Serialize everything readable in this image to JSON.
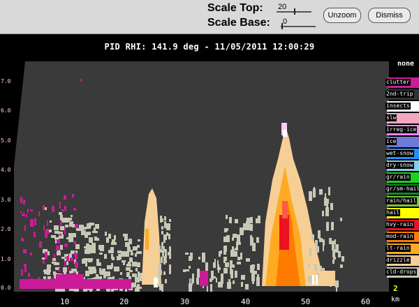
{
  "controls": {
    "scale_top_label": "Scale Top:",
    "scale_top_value": "20",
    "scale_base_label": "Scale Base:",
    "scale_base_value": "0",
    "unzoom_label": "Unzoom",
    "dismiss_label": "Dismiss"
  },
  "title": "PID  RHI: 141.9 deg  -  11/05/2011 12:00:29",
  "y_ticks": [
    "7.0",
    "6.0",
    "5.0",
    "4.0",
    "3.0",
    "2.0",
    "1.0",
    "0.0"
  ],
  "x_ticks": [
    "10",
    "20",
    "30",
    "40",
    "50",
    "60"
  ],
  "x_unit": "km",
  "legend": {
    "title": "none",
    "items": [
      {
        "label": "clutter",
        "color": "#cc1b99"
      },
      {
        "label": "2nd-trip",
        "color": "#333333"
      },
      {
        "label": "insects",
        "color": "#ffffff"
      },
      {
        "label": "slw",
        "color": "#f4a8c0"
      },
      {
        "label": "irreg-ice",
        "color": "#ee88ee"
      },
      {
        "label": "ice",
        "color": "#6e7ad8"
      },
      {
        "label": "wet-snow",
        "color": "#1e90ff"
      },
      {
        "label": "dry-snow",
        "color": "#87ceeb"
      },
      {
        "label": "gr/rain",
        "color": "#1dd21d"
      },
      {
        "label": "gr/sm-hail",
        "color": "#0f8f2f"
      },
      {
        "label": "rain/hail",
        "color": "#7cc33b"
      },
      {
        "label": "hail",
        "color": "#ffff00"
      },
      {
        "label": "hvy-rain",
        "color": "#ee1122"
      },
      {
        "label": "mod-rain",
        "color": "#ff7b00"
      },
      {
        "label": "lt-rain",
        "color": "#ffaa22"
      },
      {
        "label": "drizzle",
        "color": "#f6cf96"
      },
      {
        "label": "cld-drops",
        "color": "#c8c8b6"
      }
    ],
    "corner_value": "2"
  },
  "chart_data": {
    "type": "heatmap",
    "title": "PID  RHI: 141.9 deg  -  11/05/2011 12:00:29",
    "xlabel": "km",
    "ylabel": "",
    "xlim": [
      0,
      65
    ],
    "ylim": [
      0,
      7.5
    ],
    "x_ticks": [
      10,
      20,
      30,
      40,
      50,
      60
    ],
    "y_ticks": [
      0,
      1,
      2,
      3,
      4,
      5,
      6,
      7
    ],
    "categories": [
      "clutter",
      "2nd-trip",
      "insects",
      "slw",
      "irreg-ice",
      "ice",
      "wet-snow",
      "dry-snow",
      "gr/rain",
      "gr/sm-hail",
      "rain/hail",
      "hail",
      "hvy-rain",
      "mod-rain",
      "lt-rain",
      "drizzle",
      "cld-drops"
    ],
    "background": "#3a3a3a"
  }
}
